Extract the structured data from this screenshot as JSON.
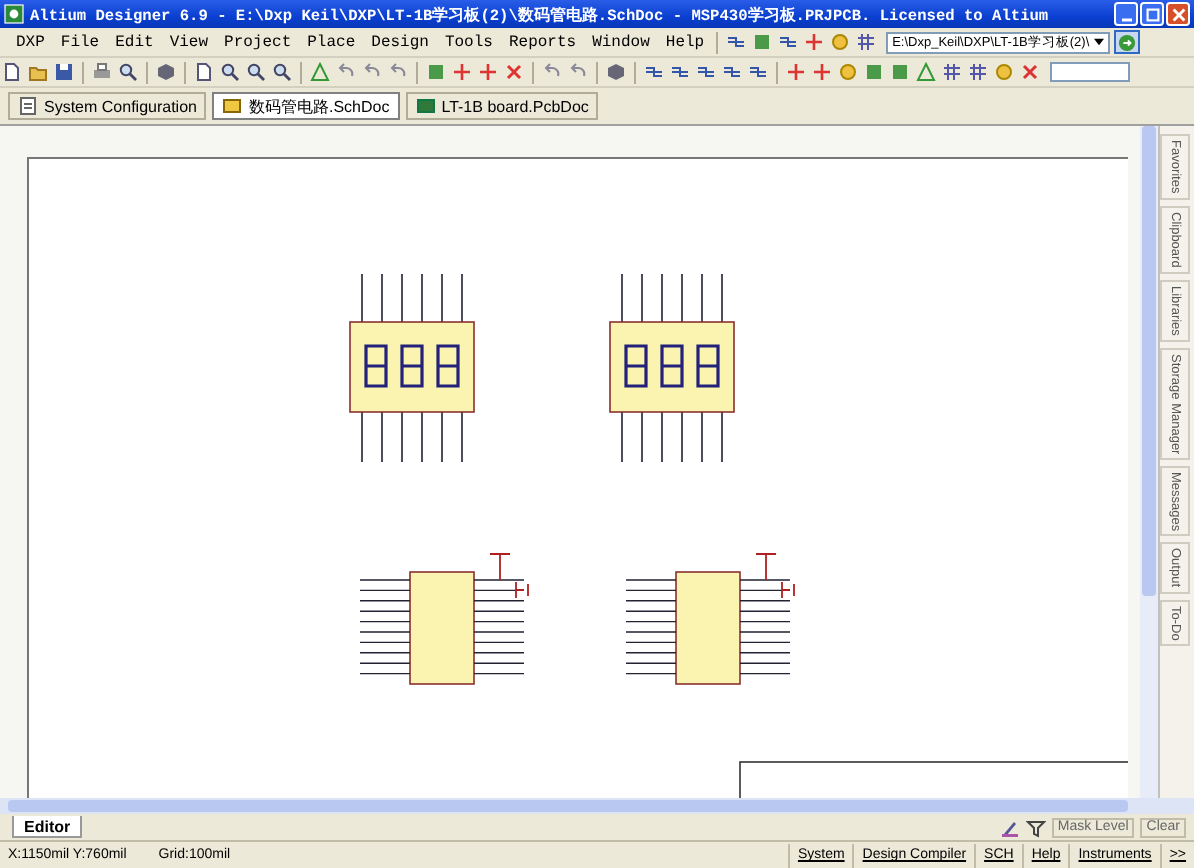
{
  "window": {
    "title": "Altium Designer 6.9 - E:\\Dxp Keil\\DXP\\LT-1B学习板(2)\\数码管电路.SchDoc - MSP430学习板.PRJPCB. Licensed to Altium"
  },
  "menu": [
    "DXP",
    "File",
    "Edit",
    "View",
    "Project",
    "Place",
    "Design",
    "Tools",
    "Reports",
    "Window",
    "Help"
  ],
  "path_combo": {
    "value": "E:\\Dxp_Keil\\DXP\\LT-1B学习板(2)\\"
  },
  "document_tabs": [
    {
      "label": "System Configuration",
      "kind": "system",
      "selected": false
    },
    {
      "label": "数码管电路.SchDoc",
      "kind": "schematic",
      "selected": true
    },
    {
      "label": "LT-1B board.PcbDoc",
      "kind": "pcb",
      "selected": false
    }
  ],
  "side_panels": [
    "Favorites",
    "Clipboard",
    "Libraries",
    "Storage Manager",
    "Messages",
    "Output",
    "To-Do"
  ],
  "panel_tabs": [
    {
      "label": "Editor",
      "selected": true
    }
  ],
  "mask_buttons": [
    "Mask Level",
    "Clear"
  ],
  "status_bar": {
    "coordinates": "X:1150mil Y:760mil",
    "grid": "Grid:100mil",
    "panels": [
      "System",
      "Design Compiler",
      "SCH",
      "Help",
      "Instruments",
      ">>"
    ]
  }
}
